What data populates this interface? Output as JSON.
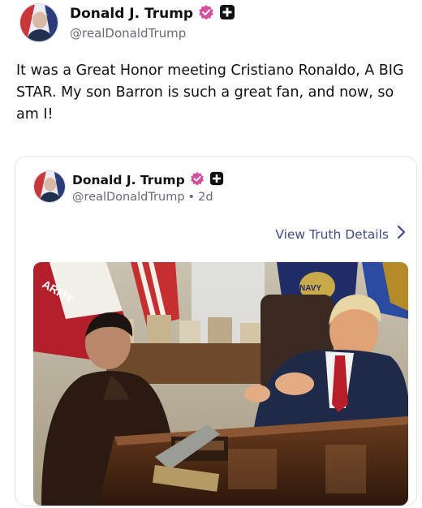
{
  "post": {
    "author": {
      "name": "Donald J. Trump",
      "handle": "@realDonaldTrump"
    },
    "text": "It was a Great Honor meeting Cristiano Ronaldo, A BIG STAR. My son Barron is such a great fan, and now, so am I!",
    "quoted": {
      "author": {
        "name": "Donald J. Trump",
        "handle": "@realDonaldTrump",
        "age": "2d"
      },
      "view_details_label": "View Truth Details",
      "image": {
        "description": "Photo of two men seated at a desk in the Oval Office",
        "flag_text_1": "ARMY",
        "flag_text_2": "NAVY"
      }
    }
  },
  "colors": {
    "verified_badge": "#d44fa0",
    "link": "#3f4a86",
    "handle": "#666b78"
  },
  "icons": [
    "verified-badge-icon",
    "plus-badge-icon",
    "chevron-right-icon"
  ]
}
